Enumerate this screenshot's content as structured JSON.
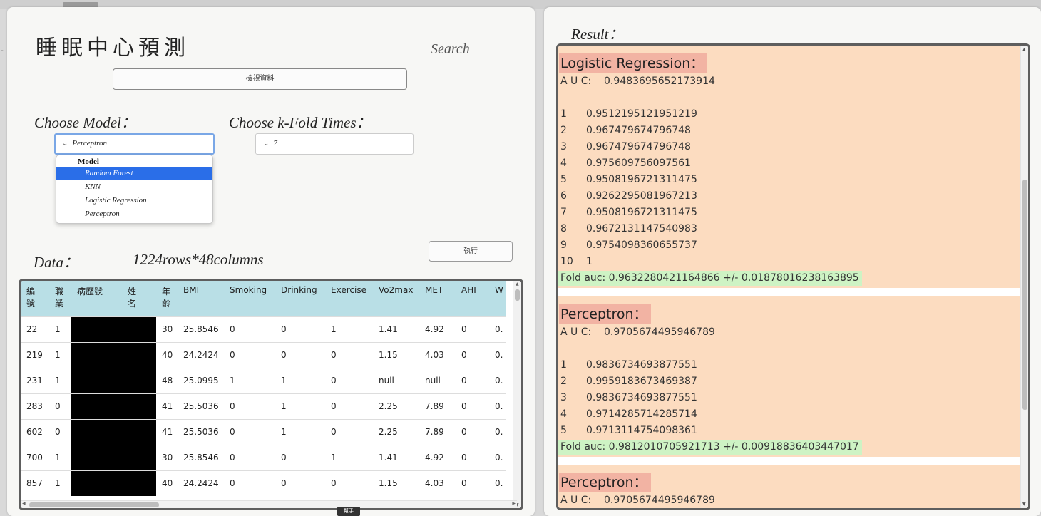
{
  "left": {
    "title": "睡眠中心預測",
    "search_label": "Search",
    "view_data_label": "檢視資料",
    "choose_model_label": "Choose Model：",
    "choose_kfold_label": "Choose k-Fold Times：",
    "model_selected": "Perceptron",
    "kfold_selected": "7",
    "dropdown": {
      "group": "Model",
      "options": [
        "Random Forest",
        "KNN",
        "Logistic Regression",
        "Perceptron"
      ],
      "highlighted": "Random Forest"
    },
    "run_label": "執行",
    "data_label": "Data：",
    "data_shape": "1224rows*48columns",
    "table": {
      "headers": [
        "編號",
        "職業",
        "病歷號",
        "姓名",
        "年齡",
        "BMI",
        "Smoking",
        "Drinking",
        "Exercise",
        "Vo2max",
        "MET",
        "AHI",
        "W"
      ],
      "rows": [
        [
          "22",
          "1",
          "",
          "",
          "30",
          "25.8546",
          "0",
          "0",
          "1",
          "1.41",
          "4.92",
          "0",
          "0."
        ],
        [
          "219",
          "1",
          "",
          "",
          "40",
          "24.2424",
          "0",
          "0",
          "0",
          "1.15",
          "4.03",
          "0",
          "0."
        ],
        [
          "231",
          "1",
          "",
          "",
          "48",
          "25.0995",
          "1",
          "1",
          "0",
          "null",
          "null",
          "0",
          "0."
        ],
        [
          "283",
          "0",
          "",
          "",
          "41",
          "25.5036",
          "0",
          "1",
          "0",
          "2.25",
          "7.89",
          "0",
          "0."
        ],
        [
          "602",
          "0",
          "",
          "",
          "41",
          "25.5036",
          "0",
          "1",
          "0",
          "2.25",
          "7.89",
          "0",
          "0."
        ],
        [
          "700",
          "1",
          "",
          "",
          "30",
          "25.8546",
          "0",
          "0",
          "1",
          "1.41",
          "4.92",
          "0",
          "0."
        ],
        [
          "857",
          "1",
          "",
          "",
          "40",
          "24.2424",
          "0",
          "0",
          "0",
          "1.15",
          "4.03",
          "0",
          "0."
        ]
      ]
    },
    "tooltip": "幫手"
  },
  "right": {
    "result_label": "Result：",
    "blocks": [
      {
        "model": "Logistic Regression：",
        "auc": "A U C:    0.9483695652173914",
        "folds": [
          [
            "1",
            "0.9512195121951219"
          ],
          [
            "2",
            "0.967479674796748"
          ],
          [
            "3",
            "0.967479674796748"
          ],
          [
            "4",
            "0.975609756097561"
          ],
          [
            "5",
            "0.9508196721311475"
          ],
          [
            "6",
            "0.9262295081967213"
          ],
          [
            "7",
            "0.9508196721311475"
          ],
          [
            "8",
            "0.9672131147540983"
          ],
          [
            "9",
            "0.9754098360655737"
          ],
          [
            "10",
            "1"
          ]
        ],
        "fold_auc": "Fold auc:  0.9632280421164866 +/- 0.01878016238163895"
      },
      {
        "model": "Perceptron：",
        "auc": "A U C:    0.9705674495946789",
        "folds": [
          [
            "1",
            "0.9836734693877551"
          ],
          [
            "2",
            "0.9959183673469387"
          ],
          [
            "3",
            "0.9836734693877551"
          ],
          [
            "4",
            "0.9714285714285714"
          ],
          [
            "5",
            "0.9713114754098361"
          ]
        ],
        "fold_auc": "Fold auc:  0.9812010705921713 +/- 0.00918836403447017"
      },
      {
        "model": "Perceptron：",
        "auc": "A U C:    0.9705674495946789",
        "folds": [],
        "fold_auc": ""
      }
    ]
  }
}
